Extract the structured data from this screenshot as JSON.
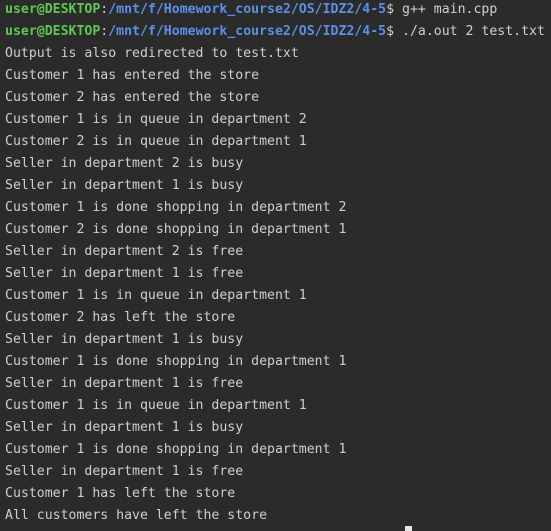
{
  "prompt": {
    "user_host": "user@DESKTOP",
    "colon": ":",
    "path": "/mnt/f/Homework_course2/OS/IDZ2/4-5",
    "dollar": "$"
  },
  "commands": [
    " g++ main.cpp",
    " ./a.out 2 test.txt"
  ],
  "output": [
    "Output is also redirected to test.txt",
    "Customer 1 has entered the store",
    "Customer 2 has entered the store",
    "Customer 1 is in queue in department 2",
    "Customer 2 is in queue in department 1",
    "Seller in department 2 is busy",
    "Seller in department 1 is busy",
    "Customer 1 is done shopping in department 2",
    "Customer 2 is done shopping in department 1",
    "Seller in department 2 is free",
    "Seller in department 1 is free",
    "Customer 1 is in queue in department 1",
    "Customer 2 has left the store",
    "Seller in department 1 is busy",
    "Customer 1 is done shopping in department 1",
    "Seller in department 1 is free",
    "Customer 1 is in queue in department 1",
    "Seller in department 1 is busy",
    "Customer 1 is done shopping in department 1",
    "Seller in department 1 is free",
    "Customer 1 has left the store",
    "All customers have left the store"
  ]
}
